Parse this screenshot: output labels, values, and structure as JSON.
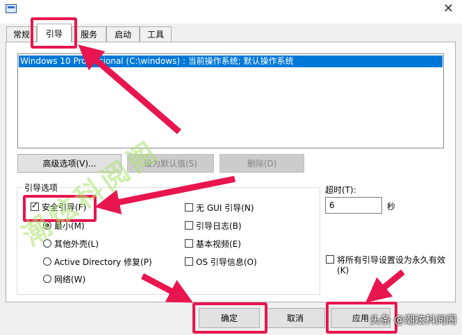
{
  "window": {
    "close_glyph": "✕"
  },
  "tabs": [
    {
      "label": "常规"
    },
    {
      "label": "引导"
    },
    {
      "label": "服务"
    },
    {
      "label": "启动"
    },
    {
      "label": "工具"
    }
  ],
  "boot_list": {
    "selected_entry": "Windows 10 Professional (C:\\windows) : 当前操作系统; 默认操作系统"
  },
  "boot_buttons": {
    "advanced": "高级选项(V)...",
    "set_default": "设为默认值(S)",
    "delete": "删除(D)"
  },
  "boot_options": {
    "legend": "引导选项",
    "safe_boot": {
      "label": "安全引导(F)",
      "checked": true
    },
    "minimal": {
      "label": "最小(M)",
      "checked": true
    },
    "alternate_shell": {
      "label": "其他外壳(L)",
      "checked": false
    },
    "active_directory": {
      "label": "Active Directory 修复(P)",
      "checked": false
    },
    "network": {
      "label": "网络(W)",
      "checked": false
    },
    "no_gui": {
      "label": "无 GUI 引导(N)",
      "checked": false
    },
    "boot_log": {
      "label": "引导日志(B)",
      "checked": false
    },
    "base_video": {
      "label": "基本视频(E)",
      "checked": false
    },
    "os_info": {
      "label": "OS 引导信息(O)",
      "checked": false
    }
  },
  "timeout": {
    "label": "超时(T):",
    "value": "6",
    "unit": "秒"
  },
  "permanent": {
    "label_line1": "将所有引导设置设为永久有效",
    "label_line2": "(K)",
    "checked": false
  },
  "footer": {
    "ok": "确定",
    "cancel": "取消",
    "apply": "应用"
  },
  "watermarks": {
    "diagonal": "潮炫科阅阁",
    "bottom": "头条 @潮炫科阅阁"
  },
  "colors": {
    "highlight": "#0078d7",
    "annotation": "#e8154e"
  }
}
